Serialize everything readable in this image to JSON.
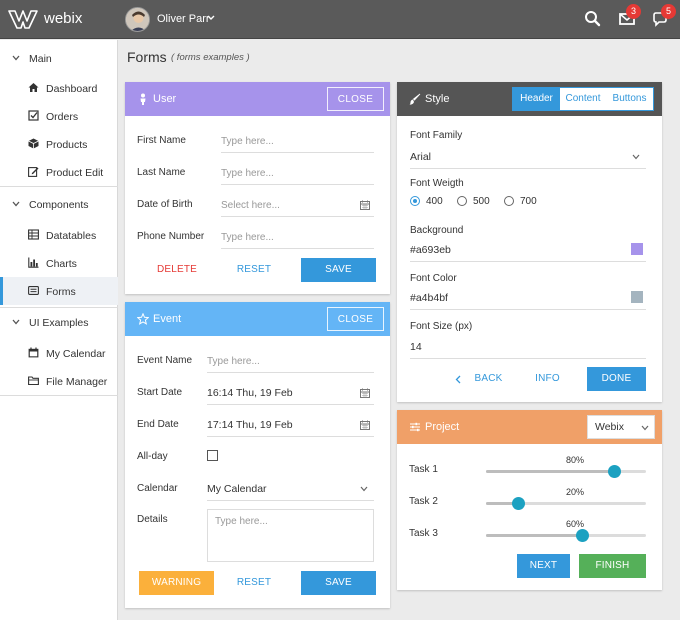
{
  "app": {
    "logo_text": "webix",
    "user_name": "Oliver Parr",
    "mail_badge": "3",
    "chat_badge": "5"
  },
  "sidebar": {
    "groups": [
      {
        "label": "Main",
        "items": [
          "Dashboard",
          "Orders",
          "Products",
          "Product Edit"
        ]
      },
      {
        "label": "Components",
        "items": [
          "Datatables",
          "Charts",
          "Forms"
        ]
      },
      {
        "label": "UI Examples",
        "items": [
          "My Calendar",
          "File Manager"
        ]
      }
    ],
    "active": "Forms"
  },
  "page": {
    "title": "Forms",
    "subtitle": "( forms examples )"
  },
  "user_panel": {
    "title": "User",
    "close": "CLOSE",
    "fields": [
      {
        "label": "First Name",
        "placeholder": "Type here..."
      },
      {
        "label": "Last Name",
        "placeholder": "Type here..."
      },
      {
        "label": "Date of Birth",
        "placeholder": "Select here..."
      },
      {
        "label": "Phone Number",
        "placeholder": "Type here..."
      }
    ],
    "delete": "DELETE",
    "reset": "RESET",
    "save": "SAVE"
  },
  "event_panel": {
    "title": "Event",
    "close": "CLOSE",
    "event_name_label": "Event Name",
    "event_name_placeholder": "Type here...",
    "start_label": "Start Date",
    "start_value": "16:14 Thu, 19 Feb",
    "end_label": "End Date",
    "end_value": "17:14 Thu, 19 Feb",
    "allday_label": "All-day",
    "allday_checked": false,
    "calendar_label": "Calendar",
    "calendar_value": "My Calendar",
    "details_label": "Details",
    "details_placeholder": "Type here...",
    "warning": "WARNING",
    "reset": "RESET",
    "save": "SAVE"
  },
  "style_panel": {
    "title": "Style",
    "tabs": [
      "Header",
      "Content",
      "Buttons"
    ],
    "active_tab": "Header",
    "font_family_label": "Font Family",
    "font_family_value": "Arial",
    "font_weight_label": "Font Weigth",
    "weights": [
      "400",
      "500",
      "700"
    ],
    "selected_weight": "400",
    "background_label": "Background",
    "background_value": "#a693eb",
    "font_color_label": "Font Color",
    "font_color_value": "#a4b4bf",
    "font_size_label": "Font Size (px)",
    "font_size_value": "14",
    "back": "BACK",
    "info": "INFO",
    "done": "DONE"
  },
  "project_panel": {
    "title": "Project",
    "select_value": "Webix",
    "tasks": [
      {
        "label": "Task 1",
        "value_text": "80%",
        "value": 0.8
      },
      {
        "label": "Task 2",
        "value_text": "20%",
        "value": 0.2
      },
      {
        "label": "Task 3",
        "value_text": "60%",
        "value": 0.6
      }
    ],
    "next": "NEXT",
    "finish": "FINISH"
  },
  "colors": {
    "topbar": "#5a5a5a",
    "user_header": "#a693eb",
    "event_header": "#64b5f6",
    "style_header": "#555555",
    "project_header": "#f0a068",
    "accent": "#3498db",
    "slider": "#1ca1c1",
    "warning": "#fbb03b",
    "finish": "#55b059",
    "danger": "#e53935"
  }
}
